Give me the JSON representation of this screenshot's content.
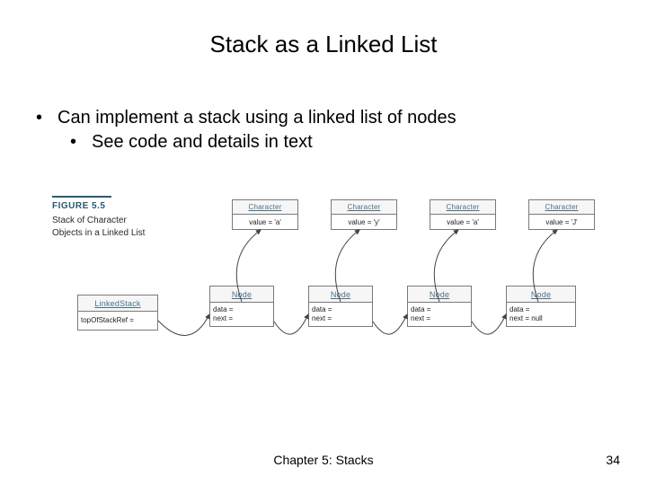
{
  "title": "Stack as a Linked List",
  "bullets": {
    "b1": "Can implement a stack using a linked list of nodes",
    "b2": "See code and details in text"
  },
  "figure": {
    "num": "FIGURE 5.5",
    "caption_l1": "Stack of Character",
    "caption_l2": "Objects in a Linked List",
    "linkedstack_title": "LinkedStack",
    "linkedstack_field": "topOfStackRef =",
    "node_title": "Node",
    "node_fields": "data =\nnext =",
    "node_fields_last": "data =\nnext = null",
    "char_title": "Character",
    "char_vals": {
      "c0": "value = 'a'",
      "c1": "value = 'y'",
      "c2": "value = 'a'",
      "c3": "value = 'J'"
    }
  },
  "footer": {
    "center": "Chapter 5: Stacks",
    "page": "34"
  }
}
